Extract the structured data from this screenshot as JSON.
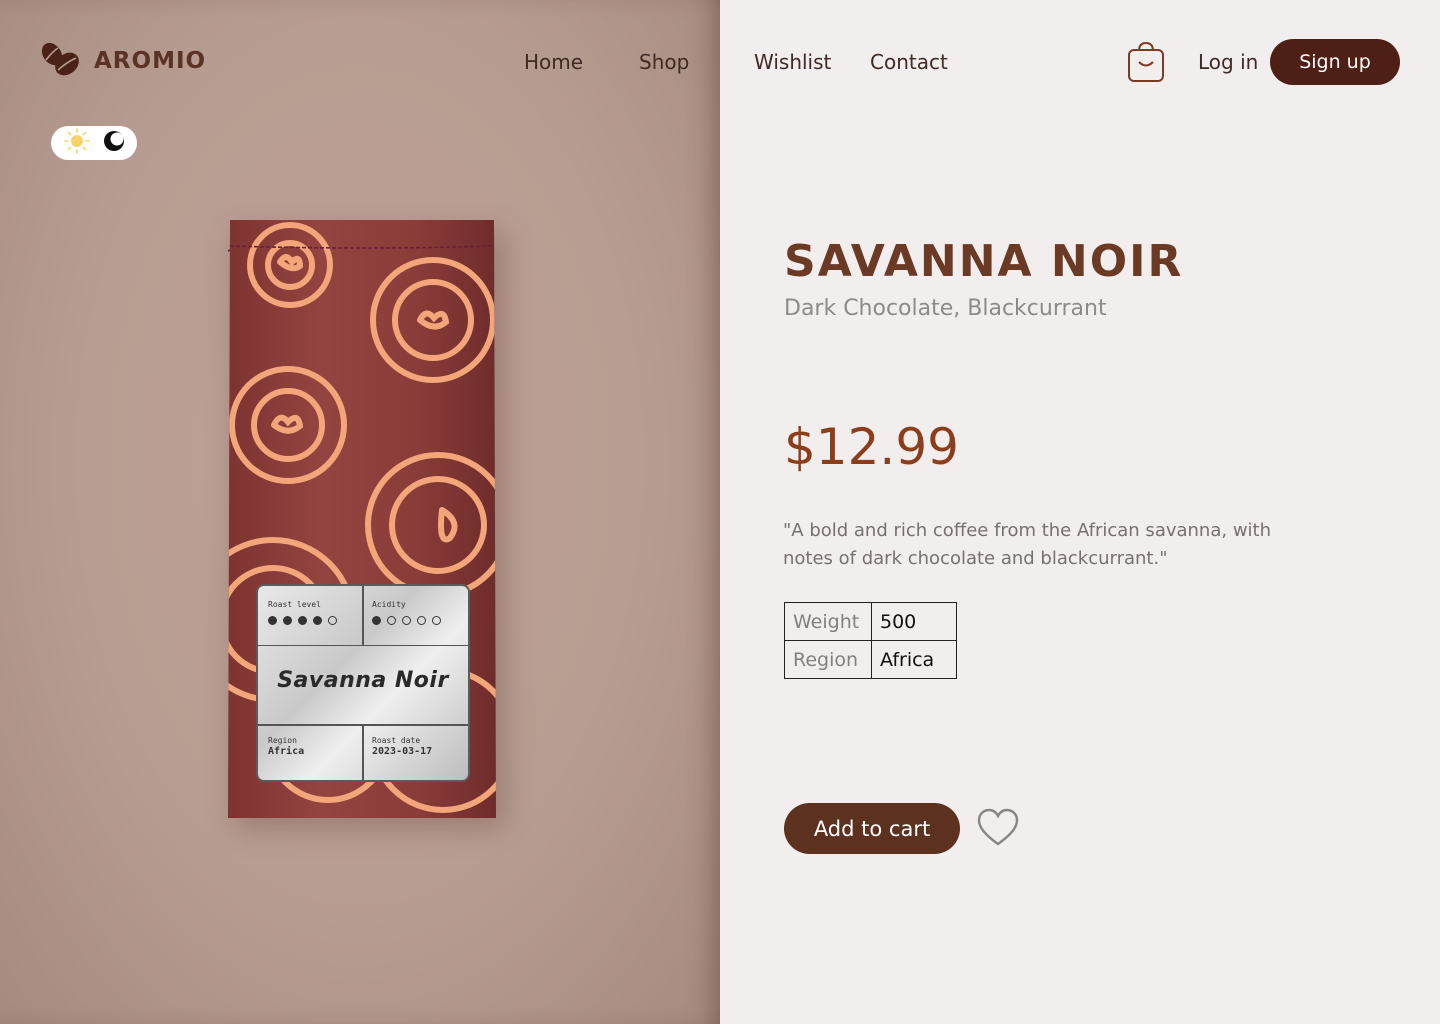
{
  "brand": {
    "name": "AROMIO"
  },
  "nav": {
    "items": [
      "Home",
      "Shop",
      "Wishlist",
      "Contact"
    ]
  },
  "auth": {
    "login_label": "Log in",
    "signup_label": "Sign up"
  },
  "theme_toggle": {
    "light_icon": "sun-icon",
    "dark_icon": "moon-icon"
  },
  "product": {
    "name": "SAVANNA NOIR",
    "notes": "Dark Chocolate, Blackcurrant",
    "price": "$12.99",
    "description": "\"A bold and rich coffee from the African savanna, with notes of dark chocolate and blackcurrant.\"",
    "specs": [
      {
        "key": "Weight",
        "value": "500"
      },
      {
        "key": "Region",
        "value": "Africa"
      }
    ],
    "add_to_cart_label": "Add to cart"
  },
  "bag_label": {
    "roast_level_label": "Roast level",
    "roast_level": 4,
    "acidity_label": "Acidity",
    "acidity": 1,
    "name": "Savanna Noir",
    "region_label": "Region",
    "region": "Africa",
    "roast_date_label": "Roast date",
    "roast_date": "2023-03-17"
  },
  "colors": {
    "accent_dark": "#4d1f15",
    "button_brown": "#5d311f",
    "price": "#8a3e1b",
    "title": "#6b3a25",
    "bag": "#8c3d3a",
    "bag_pattern": "#f2a679"
  },
  "icons": {
    "cart": "shopping-bag-icon",
    "wishlist": "heart-icon",
    "logo": "coffee-bean-icon"
  }
}
